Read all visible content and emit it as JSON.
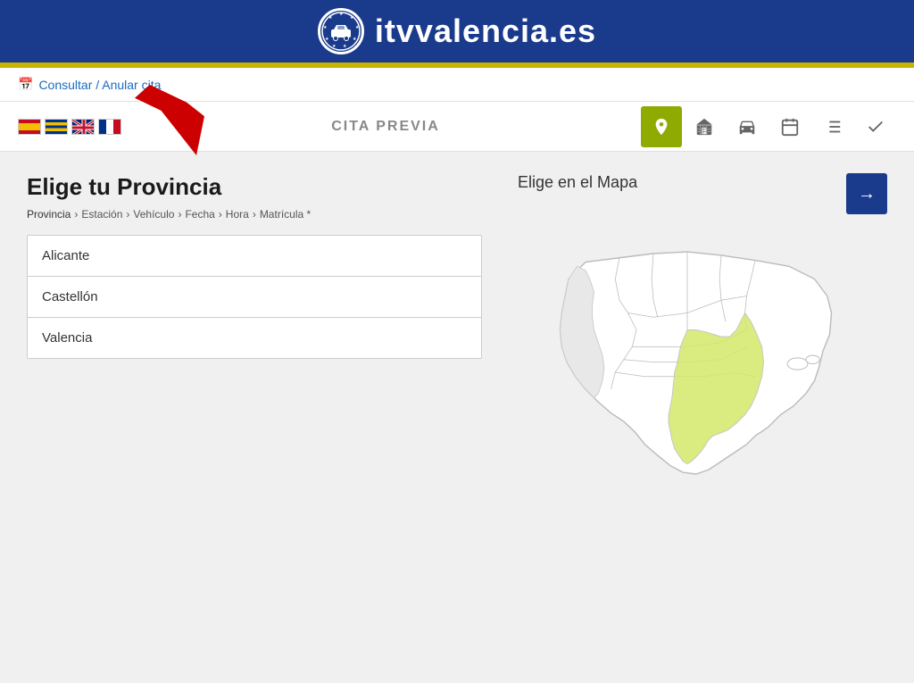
{
  "header": {
    "title": "itvvalencia.es",
    "logo_alt": "ITV Valencia logo"
  },
  "consultar_link": {
    "text": "Consultar / Anular cita",
    "icon": "📅"
  },
  "navbar": {
    "title": "CITA PREVIA",
    "flags": [
      {
        "id": "es",
        "label": "Español"
      },
      {
        "id": "ca",
        "label": "Valenciano"
      },
      {
        "id": "en",
        "label": "English"
      },
      {
        "id": "fr",
        "label": "Français"
      }
    ],
    "icons": [
      {
        "id": "location",
        "label": "Localización",
        "active": true,
        "symbol": "📍"
      },
      {
        "id": "building",
        "label": "Estación",
        "active": false,
        "symbol": "🏢"
      },
      {
        "id": "car",
        "label": "Vehículo",
        "active": false,
        "symbol": "🚗"
      },
      {
        "id": "calendar",
        "label": "Fecha",
        "active": false,
        "symbol": "📅"
      },
      {
        "id": "list",
        "label": "Lista",
        "active": false,
        "symbol": "☰"
      },
      {
        "id": "check",
        "label": "Confirmar",
        "active": false,
        "symbol": "✓"
      }
    ]
  },
  "page": {
    "title": "Elige tu Provincia",
    "breadcrumb": [
      {
        "label": "Provincia",
        "active": true
      },
      {
        "label": "Estación",
        "active": false
      },
      {
        "label": "Vehículo",
        "active": false
      },
      {
        "label": "Fecha",
        "active": false
      },
      {
        "label": "Hora",
        "active": false
      },
      {
        "label": "Matrícula *",
        "active": false
      }
    ],
    "provinces": [
      {
        "id": "alicante",
        "label": "Alicante"
      },
      {
        "id": "castellon",
        "label": "Castellón"
      },
      {
        "id": "valencia",
        "label": "Valencia"
      }
    ],
    "map_title": "Elige en el Mapa",
    "next_button_label": "→"
  }
}
